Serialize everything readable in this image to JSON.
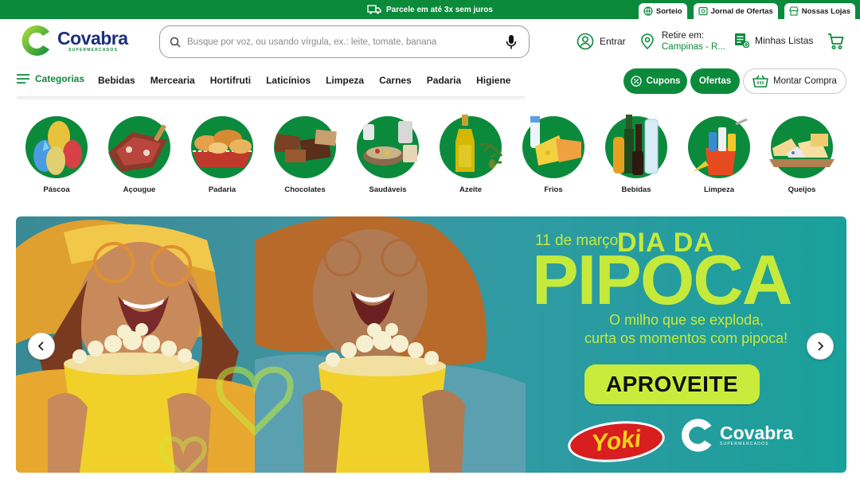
{
  "topbar": {
    "promo": "Parcele em até 3x sem juros",
    "links": [
      "Sorteio",
      "Jornal de Ofertas",
      "Nossas Lojas"
    ]
  },
  "header": {
    "logo_name": "Covabra",
    "logo_sub": "SUPERMERCADOS",
    "search_placeholder": "Busque por voz, ou usando vírgula, ex.: leite, tomate, banana",
    "login": "Entrar",
    "pickup_label": "Retire em:",
    "pickup_value": "Campinas - R...",
    "lists": "Minhas Listas"
  },
  "nav": {
    "categories": "Categorias",
    "links": [
      "Bebidas",
      "Mercearia",
      "Hortifruti",
      "Laticínios",
      "Limpeza",
      "Carnes",
      "Padaria",
      "Higiene"
    ],
    "coupons": "Cupons",
    "offers": "Ofertas",
    "build_cart": "Montar Compra"
  },
  "categories": [
    "Páscoa",
    "Açougue",
    "Padaria",
    "Chocolates",
    "Saudáveis",
    "Azeite",
    "Frios",
    "Bebidas",
    "Limpeza",
    "Queijos"
  ],
  "banner": {
    "date": "11 de março",
    "title_top": "DIA DA",
    "title_main": "PIPOCA",
    "subtitle_1": "O milho que se exploda,",
    "subtitle_2": "curta os momentos com pipoca!",
    "cta": "APROVEITE",
    "brand_1": "Yoki",
    "brand_2": "Covabra",
    "brand_2_sub": "SUPERMERCADOS"
  },
  "colors": {
    "brand_green": "#0c8a3c",
    "brand_blue": "#1c2f7a",
    "banner_lime": "#c5ea3c"
  }
}
